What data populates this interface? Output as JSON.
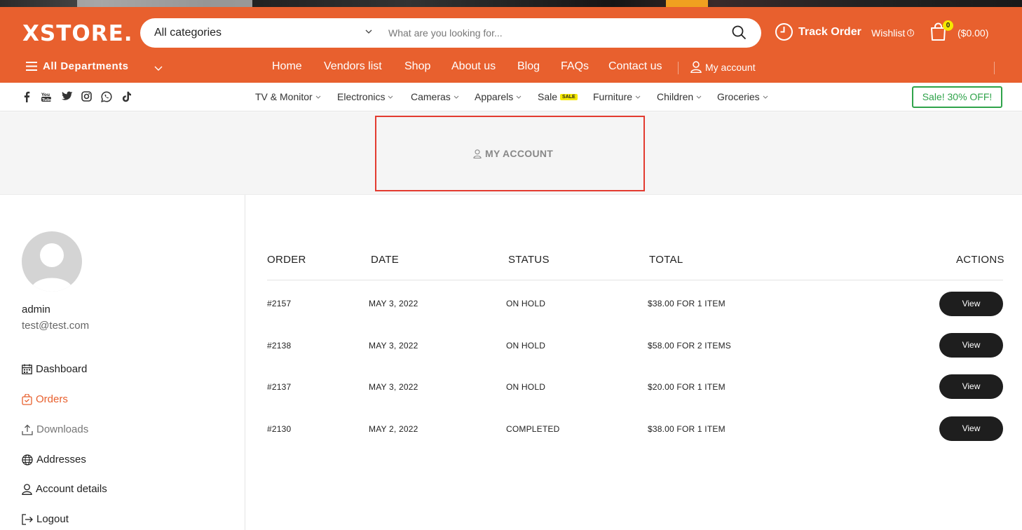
{
  "header": {
    "logo": "XSTORE.",
    "search": {
      "category": "All categories",
      "placeholder": "What are you looking for..."
    },
    "track_order": "Track Order",
    "wishlist": "Wishlist",
    "cart": {
      "count": "0",
      "total": "($0.00)"
    },
    "departments": "All Departments",
    "nav": [
      "Home",
      "Vendors list",
      "Shop",
      "About us",
      "Blog",
      "FAQs",
      "Contact us"
    ],
    "my_account": "My account",
    "colors": {
      "brand": "#e8602e",
      "badge": "#f5e800"
    }
  },
  "category_bar": {
    "social_icons": [
      "facebook-icon",
      "youtube-icon",
      "twitter-icon",
      "instagram-icon",
      "whatsapp-icon",
      "tiktok-icon"
    ],
    "items": [
      {
        "label": "TV & Monitor"
      },
      {
        "label": "Electronics"
      },
      {
        "label": "Cameras"
      },
      {
        "label": "Apparels"
      },
      {
        "label": "Sale",
        "tag": "SALE"
      },
      {
        "label": "Furniture"
      },
      {
        "label": "Children"
      },
      {
        "label": "Groceries"
      }
    ],
    "promo_button": "Sale! 30% OFF!",
    "promo_color": "#2fa34a"
  },
  "hero": {
    "title": "MY ACCOUNT"
  },
  "sidebar": {
    "username": "admin",
    "email": "test@test.com",
    "links": [
      {
        "label": "Dashboard",
        "icon": "calendar-icon"
      },
      {
        "label": "Orders",
        "icon": "shopping-bag-icon",
        "active": true
      },
      {
        "label": "Downloads",
        "icon": "upload-icon"
      },
      {
        "label": "Addresses",
        "icon": "globe-icon"
      },
      {
        "label": "Account details",
        "icon": "user-icon"
      },
      {
        "label": "Logout",
        "icon": "logout-icon"
      }
    ]
  },
  "orders": {
    "columns": [
      "ORDER",
      "DATE",
      "STATUS",
      "TOTAL",
      "ACTIONS"
    ],
    "rows": [
      {
        "order": "#2157",
        "date": "MAY 3, 2022",
        "status": "ON HOLD",
        "total": "$38.00 FOR 1 ITEM",
        "action": "View"
      },
      {
        "order": "#2138",
        "date": "MAY 3, 2022",
        "status": "ON HOLD",
        "total": "$58.00 FOR 2 ITEMS",
        "action": "View"
      },
      {
        "order": "#2137",
        "date": "MAY 3, 2022",
        "status": "ON HOLD",
        "total": "$20.00 FOR 1 ITEM",
        "action": "View"
      },
      {
        "order": "#2130",
        "date": "MAY 2, 2022",
        "status": "COMPLETED",
        "total": "$38.00 FOR 1 ITEM",
        "action": "View"
      }
    ]
  }
}
